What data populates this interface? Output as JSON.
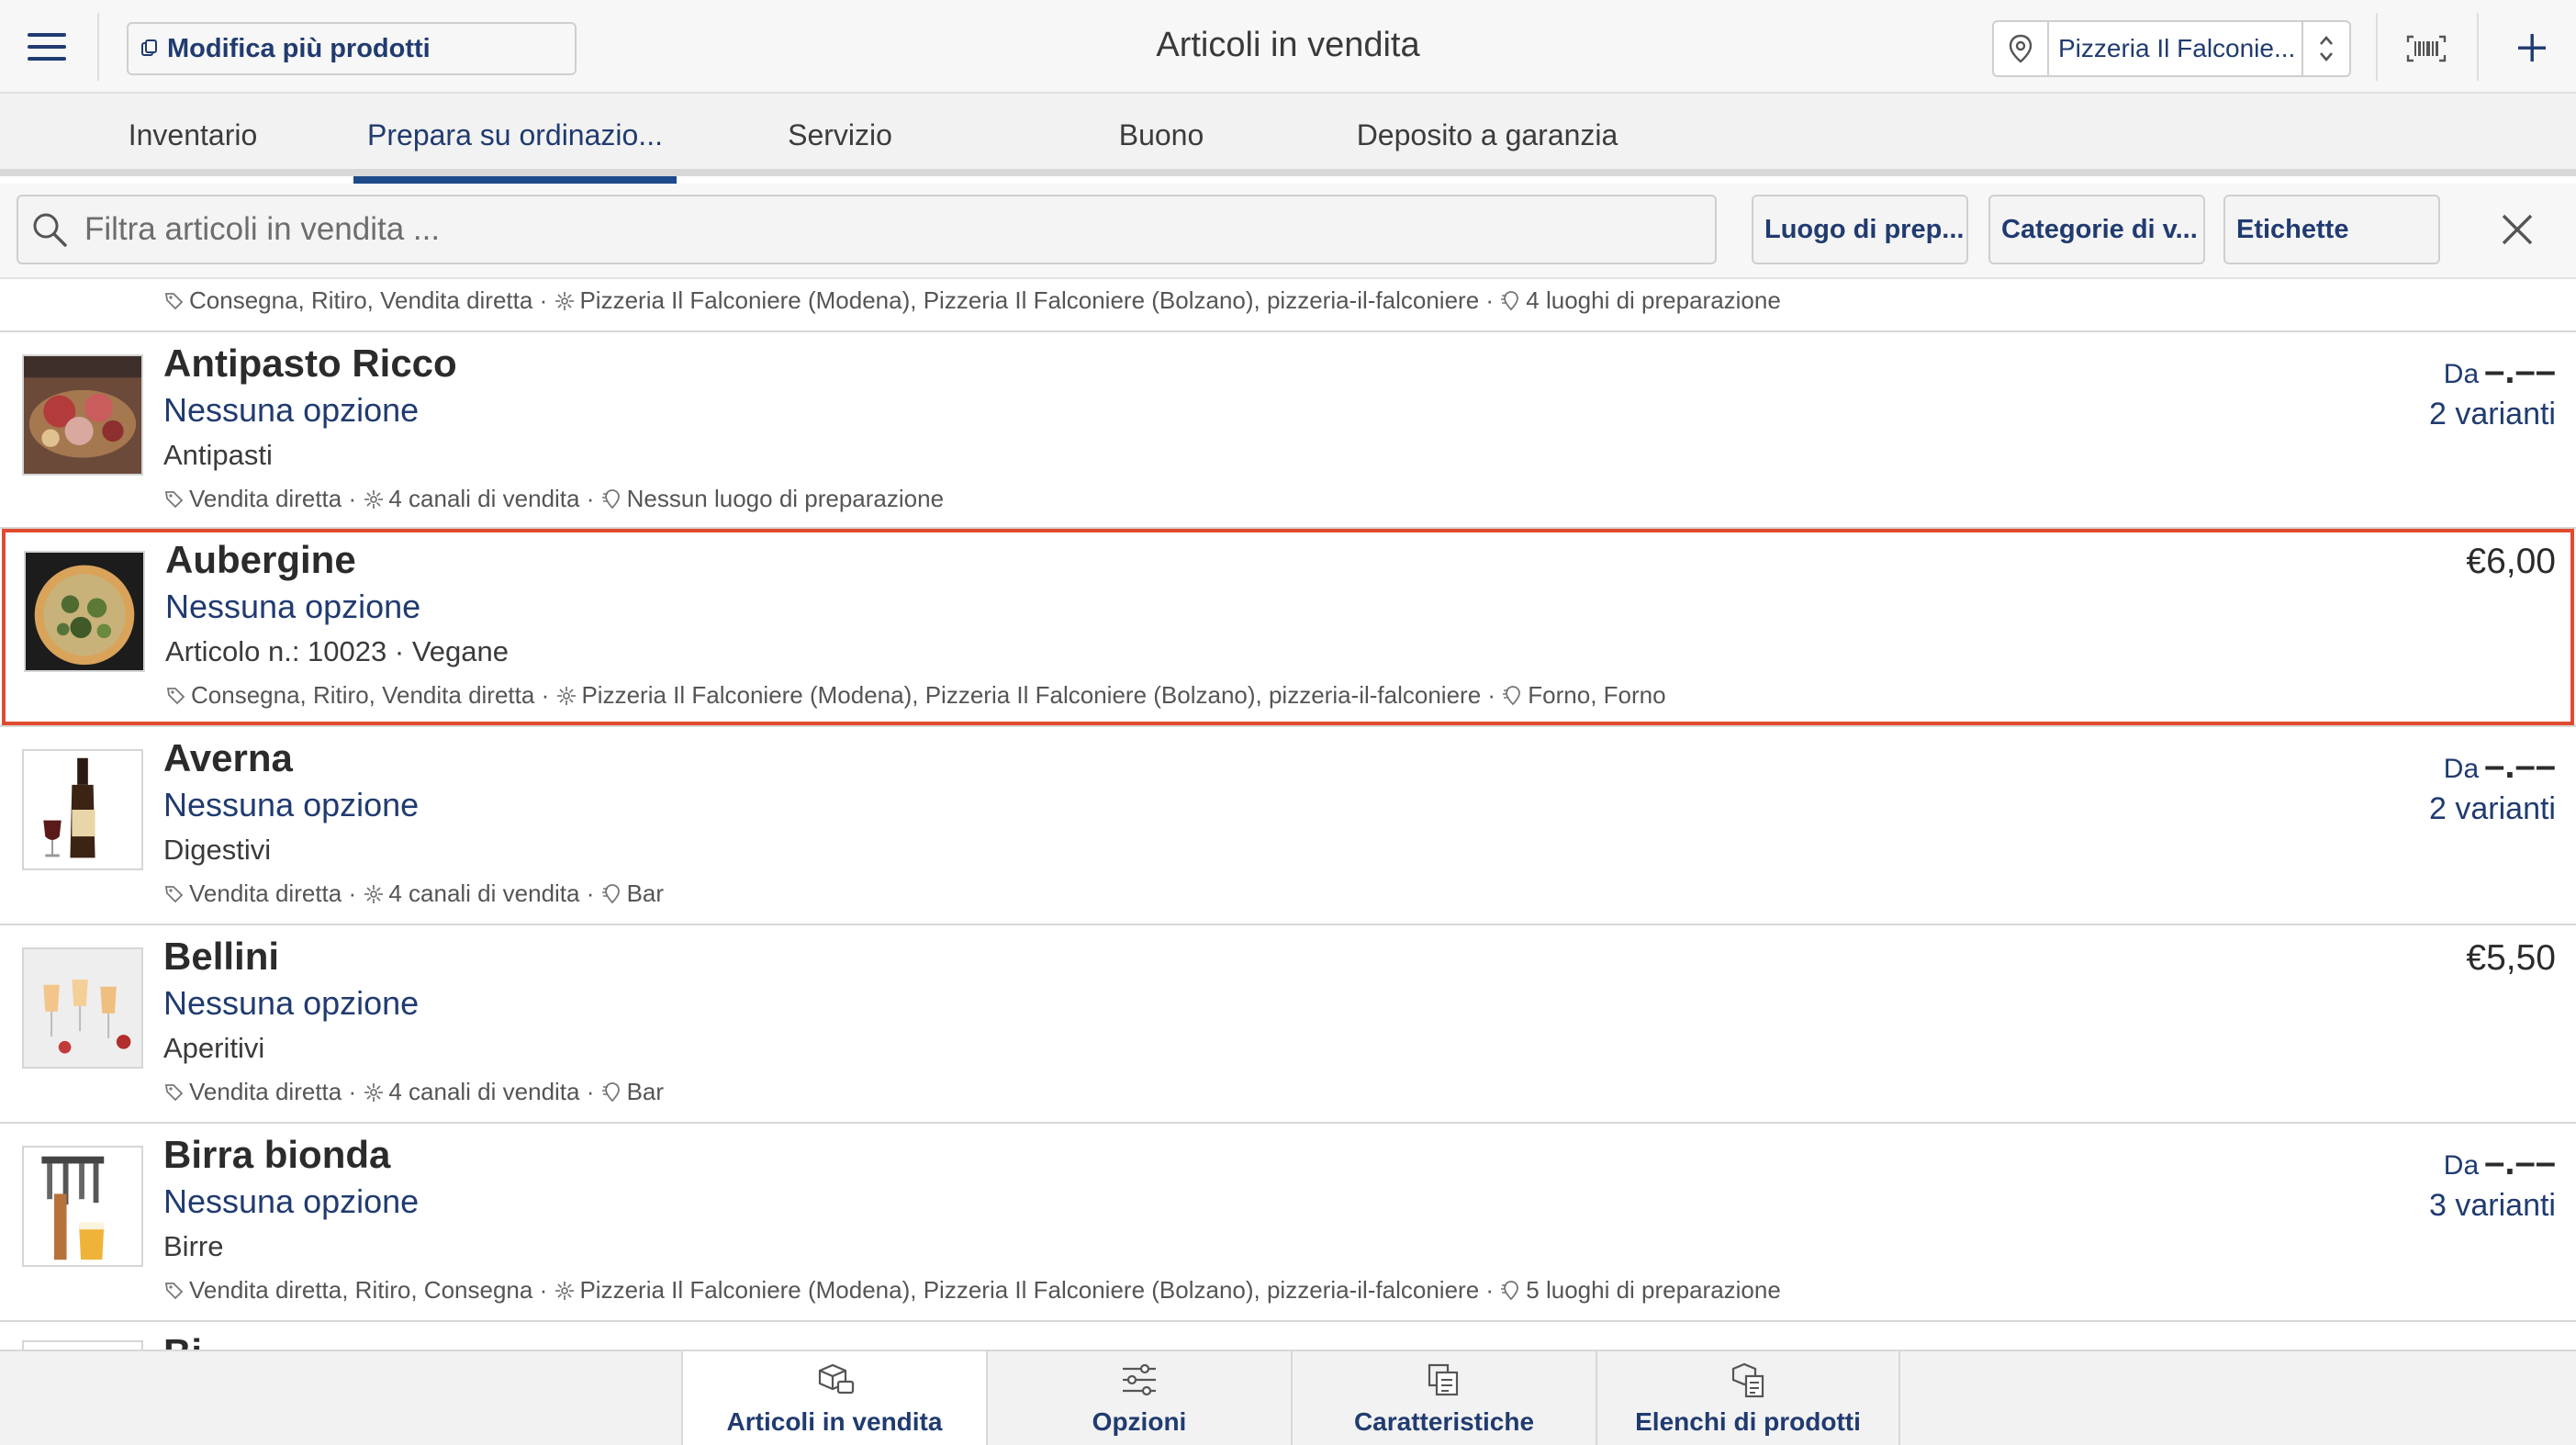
{
  "header": {
    "menu_icon": "hamburger-menu-icon",
    "edit_multiple_label": "Modifica più prodotti",
    "title": "Articoli in vendita",
    "location_value": "Pizzeria Il Falconie...",
    "location_icon": "map-pin-icon",
    "barcode_icon": "barcode-scanner-icon",
    "add_icon": "plus-icon"
  },
  "tabs": [
    {
      "label": "Inventario"
    },
    {
      "label": "Prepara su ordinazio..."
    },
    {
      "label": "Servizio"
    },
    {
      "label": "Buono"
    },
    {
      "label": "Deposito a garanzia"
    }
  ],
  "active_tab": "Prepara su ordinazio...",
  "filter": {
    "search_placeholder": "Filtra articoli in vendita ...",
    "preparation_place": "Luogo di prep...",
    "categories": "Categorie di v...",
    "labels": "Etichette"
  },
  "list": {
    "previous_item_meta": {
      "channels": "Consegna, Ritiro, Vendita diretta",
      "stores": "Pizzeria Il Falconiere (Modena), Pizzeria Il Falconiere (Bolzano), pizzeria-il-falconiere",
      "prep": "4 luoghi di preparazione"
    },
    "items": [
      {
        "name": "Antipasto Ricco",
        "option": "Nessuna opzione",
        "category": "Antipasti",
        "channels": "Vendita diretta",
        "stores": "4 canali di vendita",
        "prep": "Nessun luogo di preparazione",
        "price_prefix": "Da",
        "price": "–.––",
        "variants": "2 varianti"
      },
      {
        "name": "Aubergine",
        "option": "Nessuna opzione",
        "category": "Articolo n.: 10023 · Vegane",
        "channels": "Consegna, Ritiro, Vendita diretta",
        "stores": "Pizzeria Il Falconiere (Modena), Pizzeria Il Falconiere (Bolzano), pizzeria-il-falconiere",
        "prep": "Forno, Forno",
        "price": "€6,00",
        "selected": true
      },
      {
        "name": "Averna",
        "option": "Nessuna opzione",
        "category": "Digestivi",
        "channels": "Vendita diretta",
        "stores": "4 canali di vendita",
        "prep": "Bar",
        "price_prefix": "Da",
        "price": "–.––",
        "variants": "2 varianti"
      },
      {
        "name": "Bellini",
        "option": "Nessuna opzione",
        "category": "Aperitivi",
        "channels": "Vendita diretta",
        "stores": "4 canali di vendita",
        "prep": "Bar",
        "price": "€5,50"
      },
      {
        "name": "Birra bionda",
        "option": "Nessuna opzione",
        "category": "Birre",
        "channels": "Vendita diretta, Ritiro, Consegna",
        "stores": "Pizzeria Il Falconiere (Modena), Pizzeria Il Falconiere (Bolzano), pizzeria-il-falconiere",
        "prep": "5 luoghi di preparazione",
        "price_prefix": "Da",
        "price": "–.––",
        "variants": "3 varianti"
      }
    ],
    "next_item_partial": "Bi..."
  },
  "bottom_tabs": [
    {
      "label": "Articoli in vendita",
      "icon": "box-tag-icon"
    },
    {
      "label": "Opzioni",
      "icon": "sliders-icon"
    },
    {
      "label": "Caratteristiche",
      "icon": "attributes-icon"
    },
    {
      "label": "Elenchi di prodotti",
      "icon": "product-list-icon"
    }
  ],
  "colors": {
    "accent": "#203b70",
    "selection_border": "#e04a2f",
    "active_tab_underline": "#1d4a8a"
  }
}
